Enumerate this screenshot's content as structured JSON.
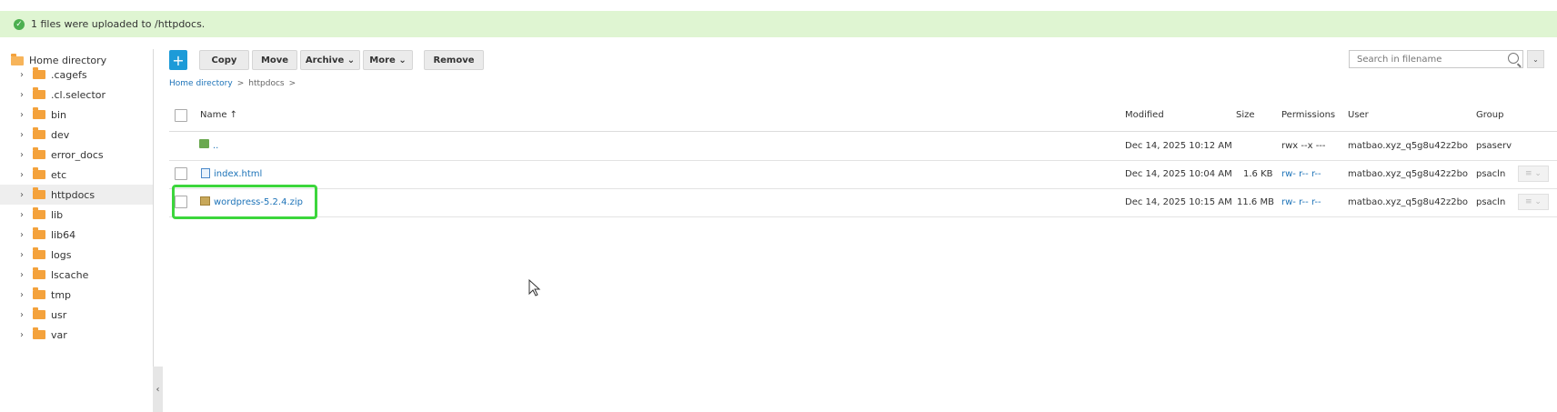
{
  "banner": {
    "message": "1 files were uploaded to /httpdocs.",
    "check_icon": "✓"
  },
  "sidebar": {
    "root_label": "Home directory",
    "items": [
      ".cagefs",
      ".cl.selector",
      "bin",
      "dev",
      "error_docs",
      "etc",
      "httpdocs",
      "lib",
      "lib64",
      "logs",
      "lscache",
      "tmp",
      "usr",
      "var"
    ],
    "selected": "httpdocs",
    "chevron": "›",
    "collapse_icon": "‹"
  },
  "toolbar": {
    "add_label": "+",
    "copy_label": "Copy",
    "move_label": "Move",
    "archive_label": "Archive ⌄",
    "more_label": "More ⌄",
    "remove_label": "Remove"
  },
  "search": {
    "placeholder": "Search in filename",
    "dropdown_icon": "⌄"
  },
  "breadcrumb": {
    "home": "Home directory",
    "sep": ">",
    "current": "httpdocs"
  },
  "table": {
    "headers": {
      "name": "Name ↑",
      "modified": "Modified",
      "size": "Size",
      "permissions": "Permissions",
      "user": "User",
      "group": "Group"
    },
    "rows": [
      {
        "name": "..",
        "modified": "Dec 14, 2025 10:12 AM",
        "size": "",
        "permissions": "rwx --x ---",
        "user": "matbao.xyz_q5g8u42z2bo",
        "group": "psaserv"
      },
      {
        "name": "index.html",
        "modified": "Dec 14, 2025 10:04 AM",
        "size": "1.6 KB",
        "permissions": "rw- r-- r--",
        "user": "matbao.xyz_q5g8u42z2bo",
        "group": "psacln"
      },
      {
        "name": "wordpress-5.2.4.zip",
        "modified": "Dec 14, 2025 10:15 AM",
        "size": "11.6 MB",
        "permissions": "rw- r-- r--",
        "user": "matbao.xyz_q5g8u42z2bo",
        "group": "psacln"
      }
    ],
    "row_menu_icon": "≡ ⌄"
  }
}
